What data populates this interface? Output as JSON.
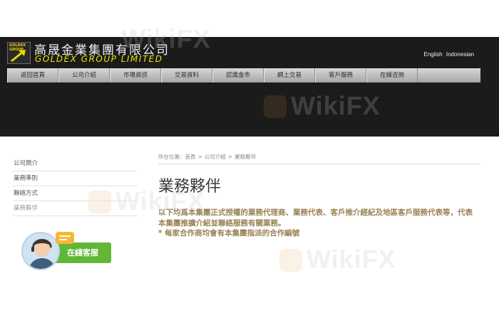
{
  "header": {
    "logo_badge_text": "GOLDEX GROUP",
    "company_cn": "高晟金業集團有限公司",
    "company_en": "GOLDEX GROUP LIMITED",
    "lang_english": "English",
    "lang_indonesian": "Indonesian"
  },
  "nav": [
    {
      "label": "返回首頁"
    },
    {
      "label": "公司介紹"
    },
    {
      "label": "市場資訊"
    },
    {
      "label": "交易資料"
    },
    {
      "label": "認識金市"
    },
    {
      "label": "網上交易"
    },
    {
      "label": "客戶服務"
    },
    {
      "label": "在線咨詢"
    }
  ],
  "sidebar": {
    "items": [
      {
        "label": "公司簡介"
      },
      {
        "label": "業務準則"
      },
      {
        "label": "聯絡方式"
      },
      {
        "label": "業務夥伴"
      }
    ],
    "customer_service_label": "在綫客服"
  },
  "breadcrumb": {
    "prefix": "所在位置：",
    "home": "首頁",
    "section": "公司介紹",
    "current": "業務夥伴",
    "separator": ">"
  },
  "main": {
    "title": "業務夥伴",
    "paragraph_1": "以下均爲本集團正式授權的業務代理商、業務代表、客戶推介經紀及地區客戶服務代表等，代表本集團推擴介紹並聯絡服務有關業務。",
    "paragraph_2": "* 每家合作商均會有本集團指派的合作編號"
  },
  "watermark": {
    "text": "WikiFX"
  },
  "colors": {
    "header_bg": "#1b1b1b",
    "company_en": "#e6e600",
    "content_text": "#9a8255",
    "cs_green": "#62b736",
    "cs_orange": "#f7b733"
  }
}
